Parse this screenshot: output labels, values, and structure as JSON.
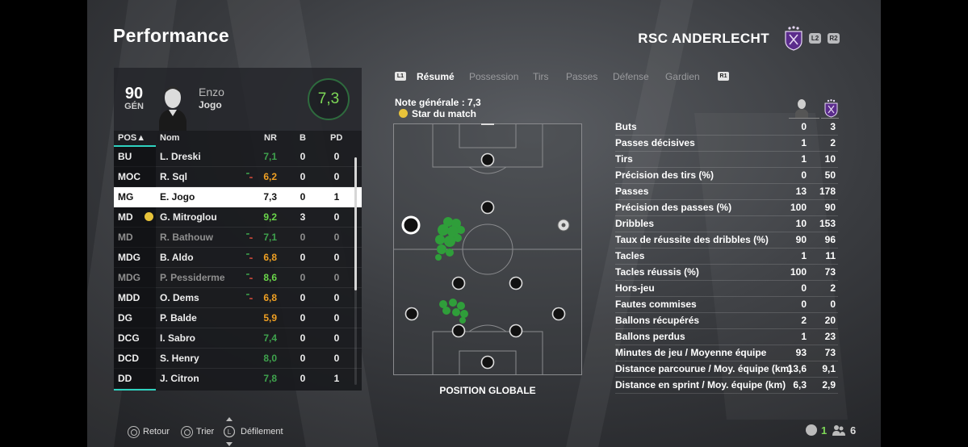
{
  "header": {
    "title": "Performance",
    "club_name": "RSC ANDERLECHT",
    "left_shoulder": "L2",
    "right_shoulder": "R2"
  },
  "player_card": {
    "overall": "90",
    "overall_label": "GÉN",
    "first_name": "Enzo",
    "last_name": "Jogo",
    "match_rating": "7,3"
  },
  "table": {
    "headers": {
      "pos": "POS▲",
      "name": "Nom",
      "nr": "NR",
      "b": "B",
      "pd": "PD"
    },
    "rows": [
      {
        "pos": "BU",
        "name": "L. Dreski",
        "nr": "7,1",
        "b": "0",
        "pd": "0",
        "nr_color": "#3fa34d",
        "trend": false,
        "star": false,
        "dim": false,
        "selected": false
      },
      {
        "pos": "MOC",
        "name": "R. Sql",
        "nr": "6,2",
        "b": "0",
        "pd": "0",
        "nr_color": "#f0a023",
        "trend": true,
        "star": false,
        "dim": false,
        "selected": false
      },
      {
        "pos": "MG",
        "name": "E. Jogo",
        "nr": "7,3",
        "b": "0",
        "pd": "1",
        "nr_color": "#111111",
        "trend": false,
        "star": false,
        "dim": false,
        "selected": true
      },
      {
        "pos": "MD",
        "name": "G. Mitroglou",
        "nr": "9,2",
        "b": "3",
        "pd": "0",
        "nr_color": "#6ad64a",
        "trend": false,
        "star": true,
        "dim": false,
        "selected": false
      },
      {
        "pos": "MD",
        "name": "R. Bathouw",
        "nr": "7,1",
        "b": "0",
        "pd": "0",
        "nr_color": "#3fa34d",
        "trend": true,
        "star": false,
        "dim": true,
        "selected": false
      },
      {
        "pos": "MDG",
        "name": "B. Aldo",
        "nr": "6,8",
        "b": "0",
        "pd": "0",
        "nr_color": "#f0a023",
        "trend": true,
        "star": false,
        "dim": false,
        "selected": false
      },
      {
        "pos": "MDG",
        "name": "P. Pessiderme",
        "nr": "8,6",
        "b": "0",
        "pd": "0",
        "nr_color": "#6ad64a",
        "trend": true,
        "star": false,
        "dim": true,
        "selected": false
      },
      {
        "pos": "MDD",
        "name": "O. Dems",
        "nr": "6,8",
        "b": "0",
        "pd": "0",
        "nr_color": "#f0a023",
        "trend": true,
        "star": false,
        "dim": false,
        "selected": false
      },
      {
        "pos": "DG",
        "name": "P. Balde",
        "nr": "5,9",
        "b": "0",
        "pd": "0",
        "nr_color": "#f0a023",
        "trend": false,
        "star": false,
        "dim": false,
        "selected": false
      },
      {
        "pos": "DCG",
        "name": "I. Sabro",
        "nr": "7,4",
        "b": "0",
        "pd": "0",
        "nr_color": "#3fa34d",
        "trend": false,
        "star": false,
        "dim": false,
        "selected": false
      },
      {
        "pos": "DCD",
        "name": "S. Henry",
        "nr": "8,0",
        "b": "0",
        "pd": "0",
        "nr_color": "#3fa34d",
        "trend": false,
        "star": false,
        "dim": false,
        "selected": false
      },
      {
        "pos": "DD",
        "name": "J. Citron",
        "nr": "7,8",
        "b": "0",
        "pd": "1",
        "nr_color": "#3fa34d",
        "trend": false,
        "star": false,
        "dim": false,
        "selected": false
      }
    ]
  },
  "tabs": {
    "left_button": "L1",
    "right_button": "R1",
    "items": [
      "Résumé",
      "Possession",
      "Tirs",
      "Passes",
      "Défense",
      "Gardien"
    ],
    "active_index": 0
  },
  "summary": {
    "overall_rating": "Note générale : 7,3",
    "motm": "Star du match",
    "pitch_label": "POSITION GLOBALE"
  },
  "stats": [
    {
      "label": "Buts",
      "player": "0",
      "club": "3"
    },
    {
      "label": "Passes décisives",
      "player": "1",
      "club": "2"
    },
    {
      "label": "Tirs",
      "player": "1",
      "club": "10"
    },
    {
      "label": "Précision des tirs (%)",
      "player": "0",
      "club": "50"
    },
    {
      "label": "Passes",
      "player": "13",
      "club": "178"
    },
    {
      "label": "Précision des passes (%)",
      "player": "100",
      "club": "90"
    },
    {
      "label": "Dribbles",
      "player": "10",
      "club": "153"
    },
    {
      "label": "Taux de réussite des dribbles (%)",
      "player": "90",
      "club": "96"
    },
    {
      "label": "Tacles",
      "player": "1",
      "club": "11"
    },
    {
      "label": "Tacles réussis (%)",
      "player": "100",
      "club": "73"
    },
    {
      "label": "Hors-jeu",
      "player": "0",
      "club": "2"
    },
    {
      "label": "Fautes commises",
      "player": "0",
      "club": "0"
    },
    {
      "label": "Ballons récupérés",
      "player": "2",
      "club": "20"
    },
    {
      "label": "Ballons perdus",
      "player": "1",
      "club": "23"
    },
    {
      "label": "Minutes de jeu / Moyenne équipe",
      "player": "93",
      "club": "73"
    },
    {
      "label": "Distance parcourue / Moy. équipe (km)",
      "player": "13,6",
      "club": "9,1"
    },
    {
      "label": "Distance en sprint / Moy. équipe (km)",
      "player": "6,3",
      "club": "2,9"
    }
  ],
  "footer": {
    "back": "Retour",
    "sort": "Trier",
    "dpad": "L",
    "scroll": "Défilement",
    "value_1": "1",
    "value_2": "6"
  },
  "colors": {
    "accent": "#2fd2c0",
    "rating_green": "#7ed957",
    "rating_orange": "#f0a023",
    "club_purple": "#5b2c8c"
  },
  "icons": {
    "player": "player-silhouette-icon",
    "club": "anderlecht-crest-icon",
    "motm": "star-ball-icon",
    "footer_left": "referee-icon",
    "footer_right": "substitutes-icon"
  }
}
